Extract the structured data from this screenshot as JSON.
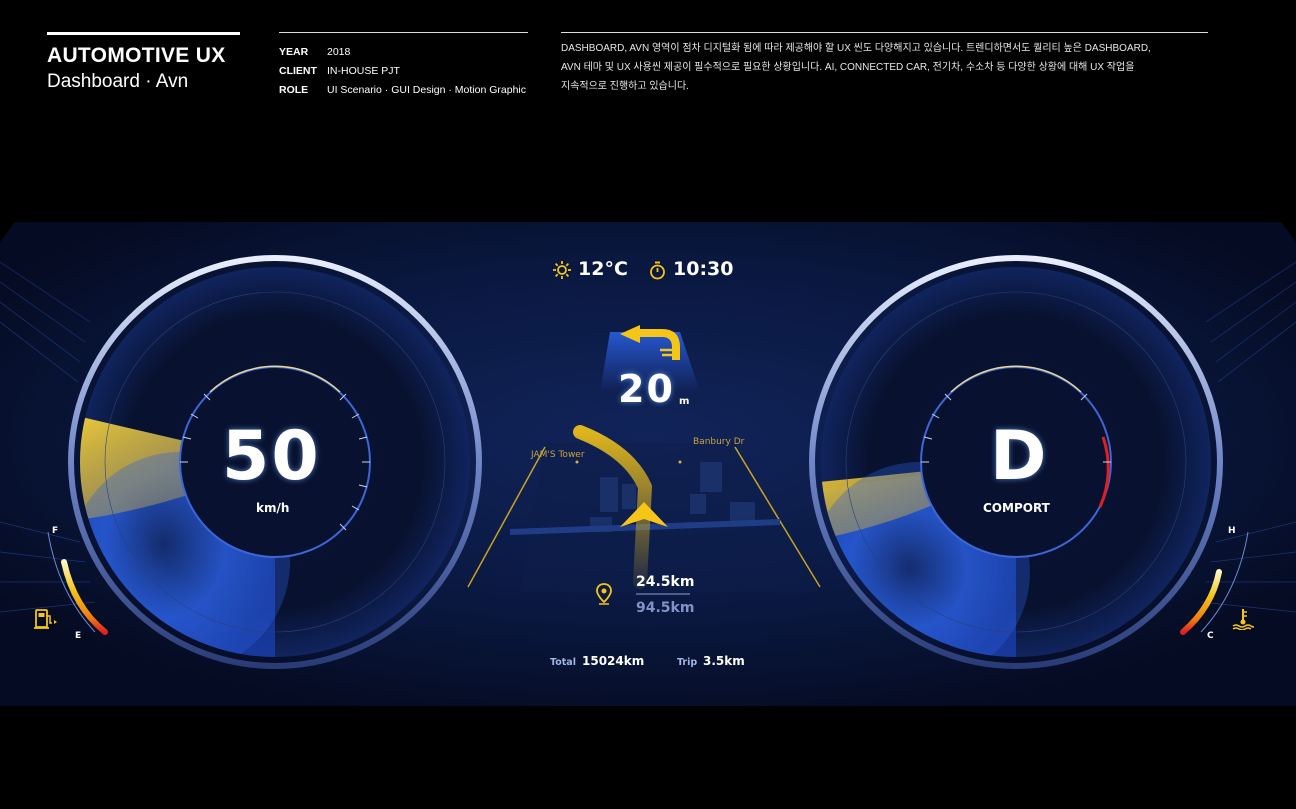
{
  "header": {
    "title": "AUTOMOTIVE UX",
    "subtitle": "Dashboard · Avn",
    "meta": [
      {
        "key": "YEAR",
        "value": "2018"
      },
      {
        "key": "CLIENT",
        "value": "IN-HOUSE PJT"
      },
      {
        "key": "ROLE",
        "value": "UI Scenario · GUI Design · Motion Graphic"
      }
    ],
    "description_lines": [
      "DASHBOARD, AVN 영역이 점차 디지털화 됨에 따라 제공해야 할 UX 씬도 다양해지고 있습니다. 트렌디하면서도  퀄리티 높은 DASHBOARD,",
      "AVN 테마 및 UX 사용씬 제공이 필수적으로 필요한 상황입니다. AI, CONNECTED  CAR, 전기차, 수소차 등 다양한 상황에 대해 UX 작업을",
      "지속적으로 진행하고 있습니다."
    ]
  },
  "cluster": {
    "temperature": "12°C",
    "clock": "10:30",
    "speed": {
      "value": "50",
      "unit": "km/h"
    },
    "gear": {
      "value": "D",
      "mode": "COMPORT"
    },
    "navigation": {
      "turn_distance": "20",
      "turn_unit": "m",
      "poi_left": "JAM'S Tower",
      "poi_right": "Banbury Dr",
      "remaining": "24.5km",
      "total_route": "94.5km"
    },
    "odometer": {
      "total_label": "Total",
      "total_value": "15024km",
      "trip_label": "Trip",
      "trip_value": "3.5km"
    },
    "fuel_gauge": {
      "full": "F",
      "empty": "E",
      "level": 0.6
    },
    "temp_gauge": {
      "hot": "H",
      "cold": "C",
      "level": 0.55
    },
    "icons": [
      "sun-icon",
      "stopwatch-icon",
      "turn-left-arrow-icon",
      "nav-cursor-icon",
      "location-pin-icon",
      "fuel-pump-icon",
      "coolant-temp-icon"
    ],
    "colors": {
      "accent_yellow": "#f5c518",
      "accent_blue": "#2a5fe0",
      "warning_red": "#e02020",
      "bg_navy": "#081334"
    }
  }
}
